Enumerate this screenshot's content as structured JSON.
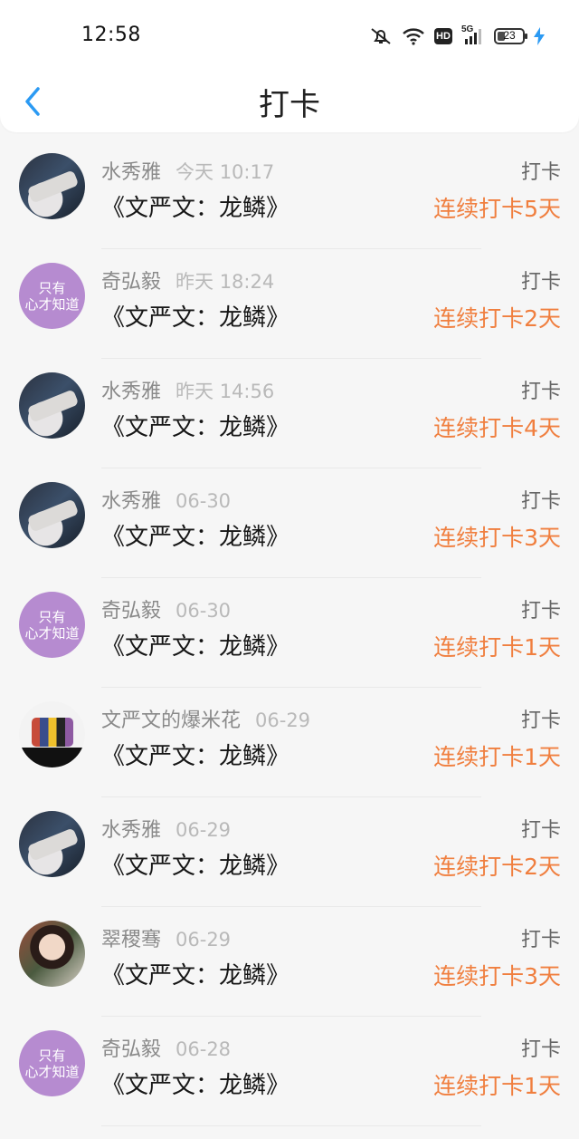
{
  "status_bar": {
    "time": "12:58",
    "hd_label": "HD",
    "network_label": "5G",
    "battery_level": "23"
  },
  "header": {
    "title": "打卡"
  },
  "items": [
    {
      "user": "水秀雅",
      "time": "今天 10:17",
      "book": "《文严文：龙鳞》",
      "type": "打卡",
      "streak": "连续打卡5天",
      "avatar_type": "photo-dark"
    },
    {
      "user": "奇弘毅",
      "time": "昨天 18:24",
      "book": "《文严文：龙鳞》",
      "type": "打卡",
      "streak": "连续打卡2天",
      "avatar_type": "purple",
      "avatar_text_1": "只有",
      "avatar_text_2": "心才知道"
    },
    {
      "user": "水秀雅",
      "time": "昨天 14:56",
      "book": "《文严文：龙鳞》",
      "type": "打卡",
      "streak": "连续打卡4天",
      "avatar_type": "photo-dark"
    },
    {
      "user": "水秀雅",
      "time": "06-30",
      "book": "《文严文：龙鳞》",
      "type": "打卡",
      "streak": "连续打卡3天",
      "avatar_type": "photo-dark"
    },
    {
      "user": "奇弘毅",
      "time": "06-30",
      "book": "《文严文：龙鳞》",
      "type": "打卡",
      "streak": "连续打卡1天",
      "avatar_type": "purple",
      "avatar_text_1": "只有",
      "avatar_text_2": "心才知道"
    },
    {
      "user": "文严文的爆米花",
      "time": "06-29",
      "book": "《文严文：龙鳞》",
      "type": "打卡",
      "streak": "连续打卡1天",
      "avatar_type": "photo-group"
    },
    {
      "user": "水秀雅",
      "time": "06-29",
      "book": "《文严文：龙鳞》",
      "type": "打卡",
      "streak": "连续打卡2天",
      "avatar_type": "photo-dark"
    },
    {
      "user": "翠稷骞",
      "time": "06-29",
      "book": "《文严文：龙鳞》",
      "type": "打卡",
      "streak": "连续打卡3天",
      "avatar_type": "photo-girl"
    },
    {
      "user": "奇弘毅",
      "time": "06-28",
      "book": "《文严文：龙鳞》",
      "type": "打卡",
      "streak": "连续打卡1天",
      "avatar_type": "purple",
      "avatar_text_1": "只有",
      "avatar_text_2": "心才知道"
    }
  ],
  "colors": {
    "accent": "#2b9af3",
    "streak": "#f07f3f",
    "avatar_purple": "#b68bd0"
  }
}
